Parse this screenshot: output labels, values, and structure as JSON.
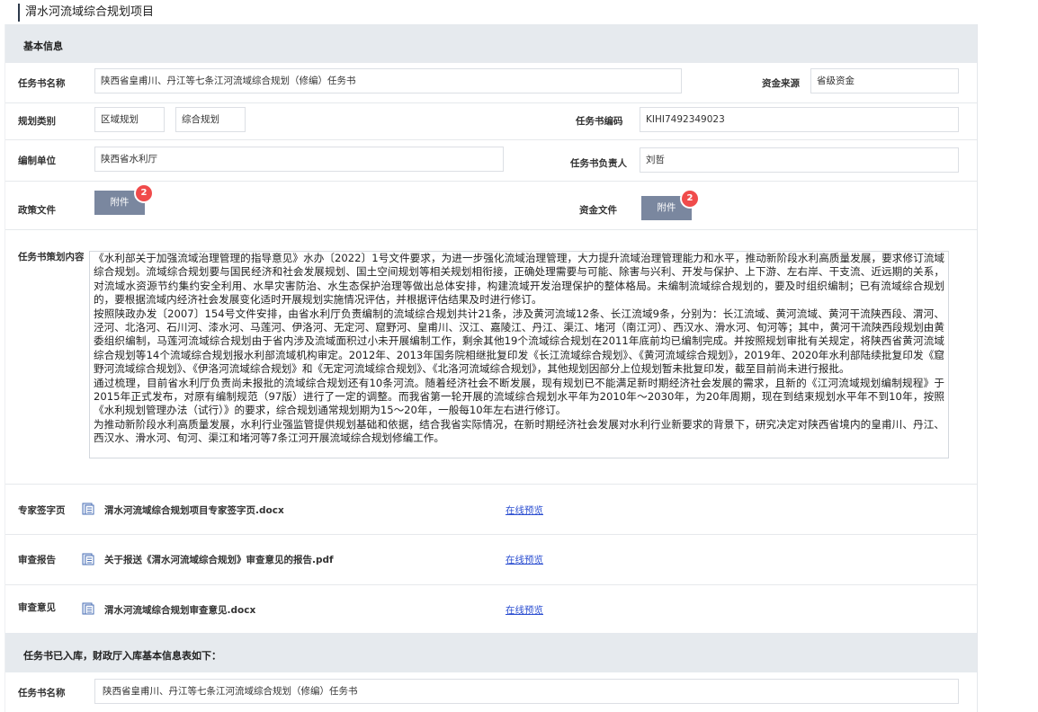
{
  "page": {
    "title": "渭水河流域综合规划项目"
  },
  "basic": {
    "header": "基本信息",
    "task_name_label": "任务书名称",
    "task_name_value": "陕西省皇甫川、丹江等七条江河流域综合规划（修编）任务书",
    "fund_source_label": "资金来源",
    "fund_source_value": "省级资金",
    "plan_category_label": "规划类别",
    "plan_category_value1": "区域规划",
    "plan_category_value2": "综合规划",
    "task_code_label": "任务书编码",
    "task_code_value": "KIHI7492349023",
    "org_label": "编制单位",
    "org_value": "陕西省水利厅",
    "owner_label": "任务书负责人",
    "owner_value": "刘哲",
    "policy_label": "政策文件",
    "policy_button": "附件",
    "policy_badge": "2",
    "fund_file_label": "资金文件",
    "fund_file_button": "附件",
    "fund_file_badge": "2",
    "content_label": "任务书策划内容",
    "content_paragraphs": [
      "《水利部关于加强流域治理管理的指导意见》水办〔2022〕1号文件要求，为进一步强化流域治理管理，大力提升流域治理管理能力和水平，推动新阶段水利高质量发展，要求修订流域综合规划。流域综合规划要与国民经济和社会发展规划、国土空间规划等相关规划相衔接，正确处理需要与可能、除害与兴利、开发与保护、上下游、左右岸、干支流、近远期的关系，对流域水资源节约集约安全利用、水旱灾害防治、水生态保护治理等做出总体安排，构建流域开发治理保护的整体格局。未编制流域综合规划的，要及时组织编制；已有流域综合规划的，要根据流域内经济社会发展变化适时开展规划实施情况评估，并根据评估结果及时进行修订。",
      "按照陕政办发〔2007〕154号文件安排，由省水利厅负责编制的流域综合规划共计21条，涉及黄河流域12条、长江流域9条，分别为：长江流域、黄河流域、黄河干流陕西段、渭河、泾河、北洛河、石川河、漆水河、马莲河、伊洛河、无定河、窟野河、皇甫川、汉江、嘉陵江、丹江、渠江、堵河（南江河）、西汉水、滑水河、旬河等；其中，黄河干流陕西段规划由黄委组织编制，马莲河流域综合规划由于省内涉及流域面积过小未开展编制工作，剩余其他19个流域综合规划在2011年底前均已编制完成。并按照规划审批有关规定，将陕西省黄河流域综合规划等14个流域综合规划报水利部流域机构审定。2012年、2013年国务院相继批复印发《长江流域综合规划》、《黄河流域综合规划》，2019年、2020年水利部陆续批复印发《窟野河流域综合规划》、《伊洛河流域综合规划》和《无定河流域综合规划》、《北洛河流域综合规划》，其他规划因部分上位规划暂未批复印发，截至目前尚未进行报批。",
      "通过梳理，目前省水利厅负责尚未报批的流域综合规划还有10条河流。随着经济社会不断发展，现有规划已不能满足新时期经济社会发展的需求，且新的《江河流域规划编制规程》于2015年正式发布，对原有编制规范（97版）进行了一定的调整。而我省第一轮开展的流域综合规划水平年为2010年～2030年，为20年周期，现在到结束规划水平年不到10年，按照《水利规划管理办法（试行）》的要求，综合规划通常规划期为15～20年，一般每10年左右进行修订。",
      "为推动新阶段水利高质量发展，水利行业强监管提供规划基础和依据，结合我省实际情况，在新时期经济社会发展对水利行业新要求的背景下，研究决定对陕西省境内的皇甫川、丹江、西汉水、滑水河、旬河、渠江和堵河等7条江河开展流域综合规划修编工作。"
    ]
  },
  "files": [
    {
      "label": "专家签字页",
      "name": "渭水河流域综合规划项目专家签字页.docx",
      "link": "在线预览",
      "icon": "document-icon"
    },
    {
      "label": "审查报告",
      "name": "关于报送《渭水河流域综合规划》审查意见的报告.pdf",
      "link": "在线预览",
      "icon": "document-icon"
    },
    {
      "label": "审查意见",
      "name": "渭水河流域综合规划审查意见.docx",
      "link": "在线预览",
      "icon": "document-icon"
    }
  ],
  "storage": {
    "header": "任务书已入库，财政厅入库基本信息表如下：",
    "task_name_label": "任务书名称",
    "task_name_value": "陕西省皇甫川、丹江等七条江河流域综合规划（修编）任务书"
  }
}
